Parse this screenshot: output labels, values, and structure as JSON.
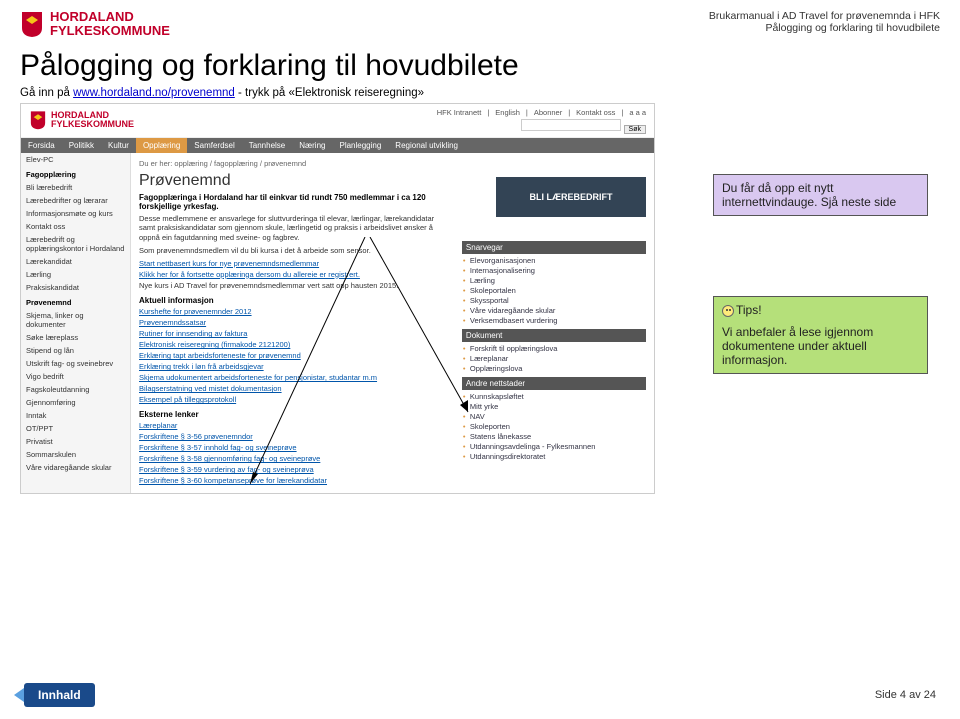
{
  "header": {
    "logo_line1": "HORDALAND",
    "logo_line2": "FYLKESKOMMUNE",
    "right_line1": "Brukarmanual i AD Travel for prøvenemnda i HFK",
    "right_line2": "Pålogging og forklaring til hovudbilete"
  },
  "title": "Pålogging og forklaring til hovudbilete",
  "intro": {
    "pre": "Gå inn på ",
    "link": "www.hordaland.no/provenemnd",
    "post": " - trykk på «Elektronisk reiseregning»"
  },
  "callouts": {
    "purple": "Du får då opp eit nytt internettvindauge. Sjå neste side",
    "green_title": "Tips!",
    "green_body": "Vi anbefaler å lese igjennom dokumentene under aktuell informasjon."
  },
  "footer": {
    "button": "Innhald",
    "page": "Side 4 av 24"
  },
  "ss": {
    "logo_line1": "HORDALAND",
    "logo_line2": "FYLKESKOMMUNE",
    "toplinks": [
      "HFK Intranett",
      "English",
      "Abonner",
      "Kontakt oss",
      "a a a"
    ],
    "search_btn": "Søk",
    "nav": [
      "Forsida",
      "Politikk",
      "Kultur",
      "Opplæring",
      "Samferdsel",
      "Tannhelse",
      "Næring",
      "Planlegging",
      "Regional utvikling"
    ],
    "nav_active": "Opplæring",
    "sidebar": {
      "top": "Elev-PC",
      "g1": "Fagopplæring",
      "g1_items": [
        "Bli lærebedrift",
        "Lærebedrifter og lærarar",
        "Informasjonsmøte og kurs",
        "Kontakt oss",
        "Lærebedrift og opplæringskontor i Hordaland",
        "Lærekandidat",
        "Lærling",
        "Praksiskandidat"
      ],
      "g2": "Prøvenemnd",
      "g2_items": [
        "Skjema, linker og dokumenter",
        "Søke læreplass",
        "Stipend og lån",
        "Utskrift fag- og sveinebrev",
        "Vigo bedrift"
      ],
      "g3_items": [
        "Fagskoleutdanning",
        "Gjennomføring",
        "Inntak",
        "OT/PPT",
        "Privatist",
        "Sommarskulen",
        "Våre vidaregåande skular"
      ]
    },
    "breadcrumb": "Du er her: opplæring / fagopplæring / prøvenemnd",
    "h1": "Prøvenemnd",
    "lead": "Fagopplæringa i Hordaland har til einkvar tid rundt 750 medlemmar i ca 120 forskjellige yrkesfag.",
    "banner": "BLI LÆREBEDRIFT",
    "p1": "Desse medlemmene er ansvarlege for sluttvurderinga til elevar, lærlingar, lærekandidatar samt praksiskandidatar som gjennom skule, lærlingetid og praksis i arbeidslivet ønsker å oppnå ein fagutdanning med sveine- og fagbrev.",
    "p2": "Som prøvenemndsmedlem vil du bli kursa i det å arbeide som sensor.",
    "link1": "Start nettbasert kurs for nye prøvenemndsmedlemmar",
    "link2": "Klikk her for å fortsette opplæringa dersom du allereie er registrert.",
    "p3": "Nye kurs i AD Travel for prøvenemndsmedlemmar vert satt opp hausten 2015.",
    "sec_aktuell": "Aktuell informasjon",
    "aktuell_links": [
      "Kurshefte for prøvenemnder 2012",
      "Prøvenemndssatsar",
      "Rutiner for innsending av faktura",
      "Elektronisk reiseregning (firmakode 2121200)",
      "Erklæring tapt arbeidsforteneste for prøvenemnd",
      "Erklæring trekk i løn frå arbeidsgjevar",
      "Skjema udokumentert arbeidsforteneste for pensjonistar, studantar m.m",
      "Bilagserstatning ved mistet dokumentasjon",
      "Eksempel på tilleggsprotokoll"
    ],
    "sec_ekstern": "Eksterne lenker",
    "ekstern_links": [
      "Læreplanar",
      "Forskriftene § 3-56 prøvenemndor",
      "Forskriftene § 3-57 innhold fag- og sveineprøve",
      "Forskriftene § 3-58 gjennomføring fag- og sveineprøve",
      "Forskriftene § 3-59 vurdering av fag- og sveineprøva",
      "Forskriftene § 3-60 kompetanseprøve for lærekandidatar"
    ],
    "box_snarvegar": "Snarvegar",
    "snarvegar": [
      "Elevorganisasjonen",
      "Internasjonalisering",
      "Lærling",
      "Skoleportalen",
      "Skyssportal",
      "Våre vidaregåande skular",
      "Verksemdbasert vurdering"
    ],
    "box_dokument": "Dokument",
    "dokument": [
      "Forskrift til opplæringslova",
      "Læreplanar",
      "Opplæringslova"
    ],
    "box_andre": "Andre nettstader",
    "andre": [
      "Kunnskapsløftet",
      "Mitt yrke",
      "NAV",
      "Skoleporten",
      "Statens lånekasse",
      "Utdanningsavdelinga - Fylkesmannen",
      "Utdanningsdirektoratet"
    ]
  }
}
